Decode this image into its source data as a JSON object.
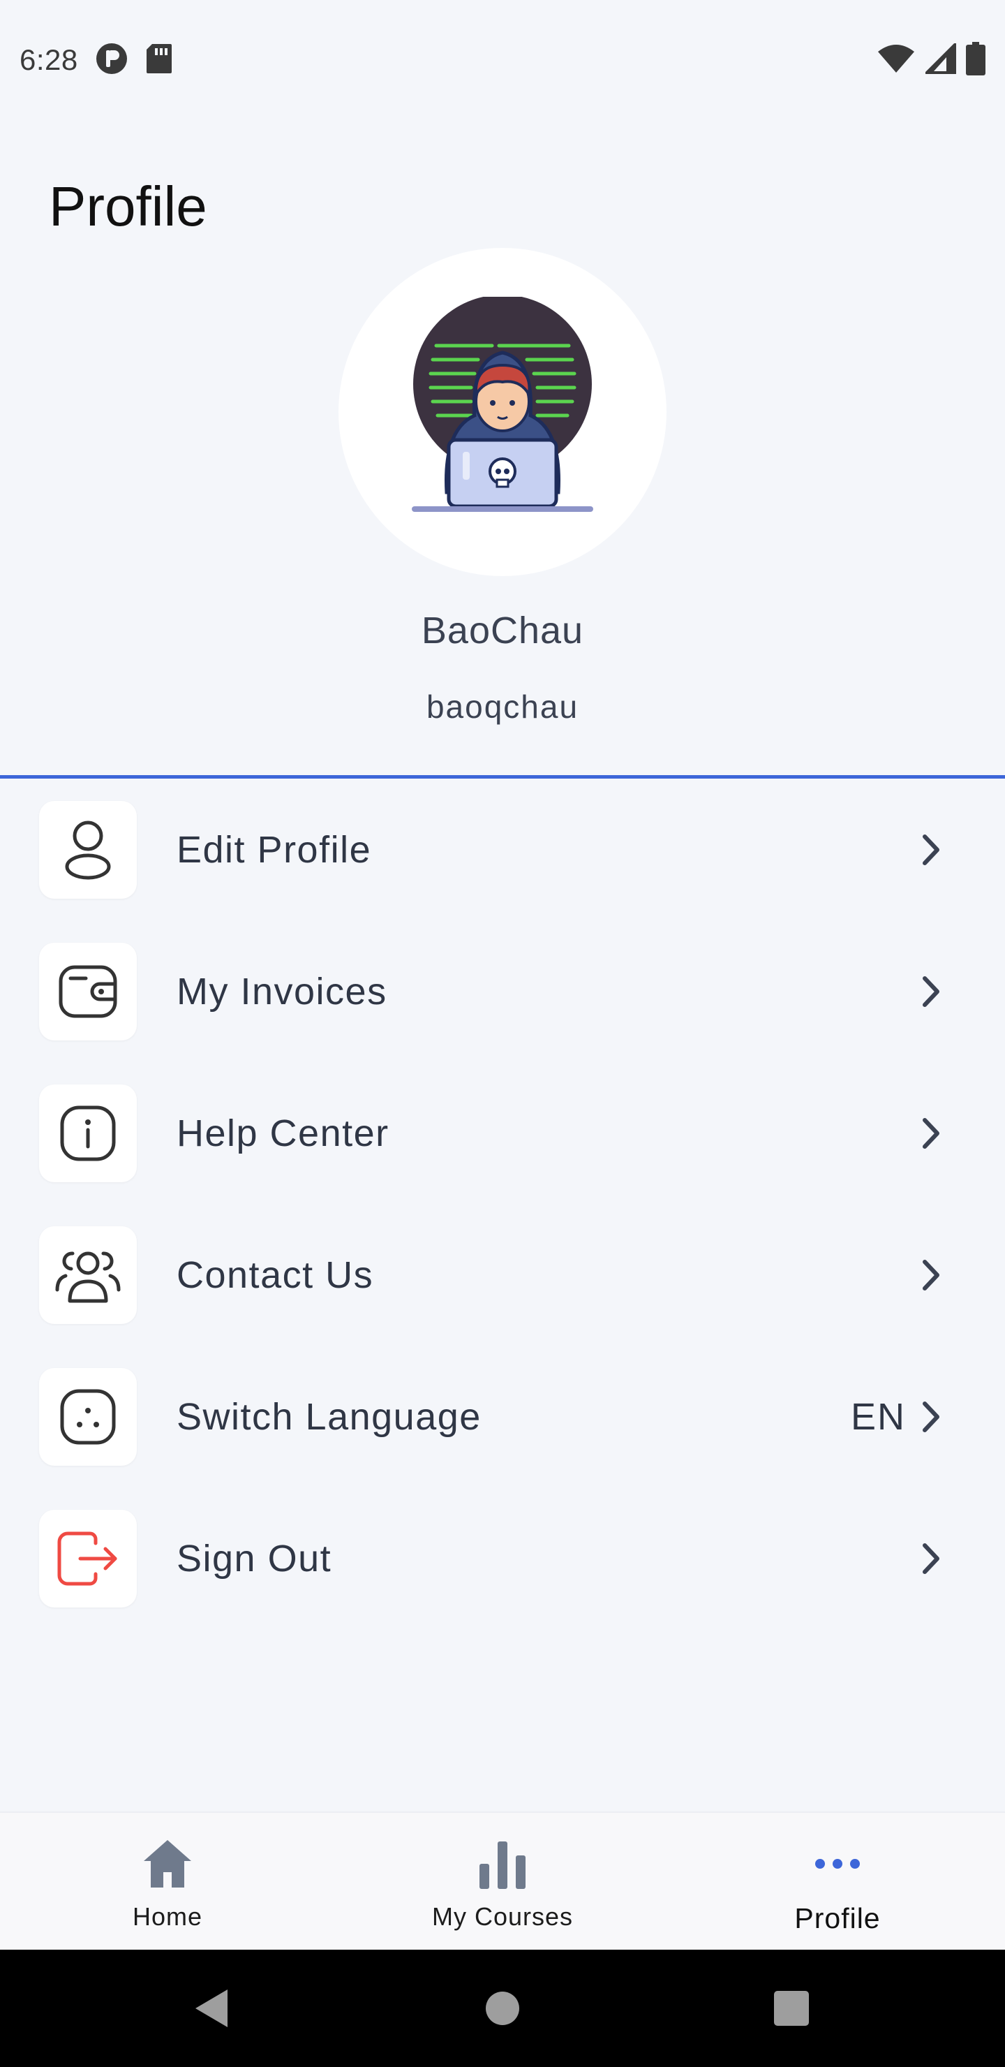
{
  "status_bar": {
    "time": "6:28",
    "icons": [
      "notification-p-icon",
      "sd-card-icon",
      "wifi-icon",
      "signal-icon",
      "battery-icon"
    ]
  },
  "page": {
    "title": "Profile"
  },
  "profile": {
    "display_name": "BaoChau",
    "username": "baoqchau",
    "avatar_icon": "hacker-avatar-icon"
  },
  "accent_color": "#3d66d9",
  "menu": {
    "items": [
      {
        "label": "Edit Profile",
        "icon": "user-icon",
        "value": ""
      },
      {
        "label": "My Invoices",
        "icon": "wallet-icon",
        "value": ""
      },
      {
        "label": "Help Center",
        "icon": "info-icon",
        "value": ""
      },
      {
        "label": "Contact Us",
        "icon": "users-icon",
        "value": ""
      },
      {
        "label": "Switch Language",
        "icon": "dice-icon",
        "value": "EN"
      },
      {
        "label": "Sign Out",
        "icon": "logout-icon",
        "value": ""
      }
    ]
  },
  "bottom_nav": {
    "items": [
      {
        "label": "Home",
        "icon": "home-icon",
        "active": false
      },
      {
        "label": "My Courses",
        "icon": "bar-chart-icon",
        "active": false
      },
      {
        "label": "Profile",
        "icon": "more-dots-icon",
        "active": true
      }
    ]
  },
  "system_nav": {
    "icons": [
      "back-icon",
      "home-circle-icon",
      "recents-icon"
    ]
  }
}
